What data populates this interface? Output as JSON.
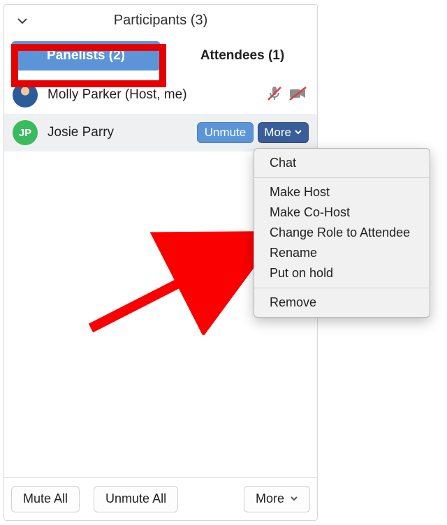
{
  "header": {
    "title": "Participants (3)"
  },
  "tabs": {
    "panelists": "Panelists (2)",
    "attendees": "Attendees (1)"
  },
  "participants": [
    {
      "avatar_type": "photo",
      "name": "Molly Parker (Host, me)",
      "mic_muted": true,
      "cam_off": true
    },
    {
      "avatar_type": "initials",
      "initials": "JP",
      "name": "Josie Parry"
    }
  ],
  "row_buttons": {
    "unmute": "Unmute",
    "more": "More"
  },
  "menu": {
    "chat": "Chat",
    "make_host": "Make Host",
    "make_cohost": "Make Co-Host",
    "change_role": "Change Role to Attendee",
    "rename": "Rename",
    "hold": "Put on hold",
    "remove": "Remove"
  },
  "footer": {
    "mute_all": "Mute All",
    "unmute_all": "Unmute All",
    "more": "More"
  }
}
